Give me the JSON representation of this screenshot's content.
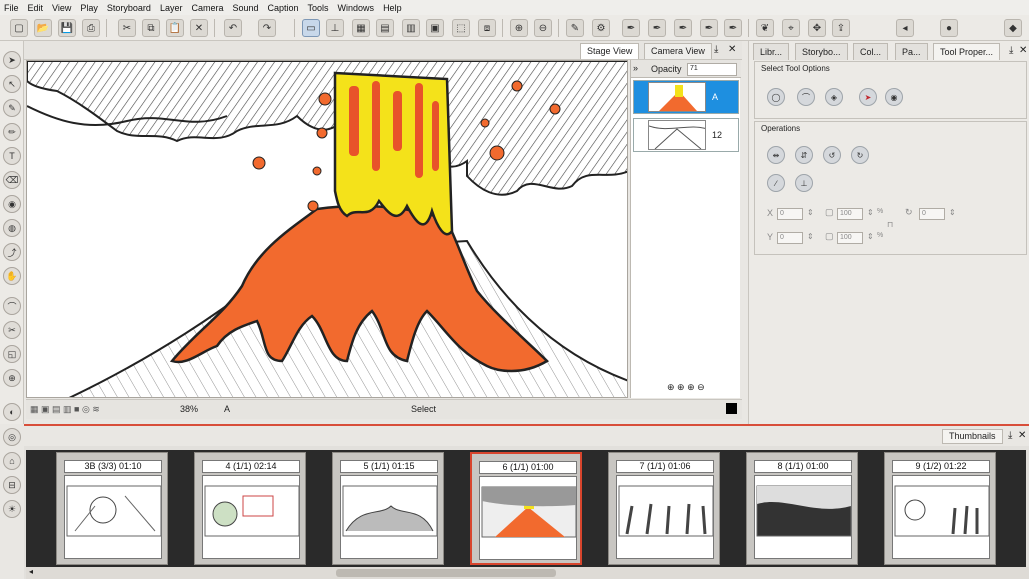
{
  "menu": [
    "File",
    "Edit",
    "View",
    "Play",
    "Storyboard",
    "Layer",
    "Camera",
    "Sound",
    "Caption",
    "Tools",
    "Windows",
    "Help"
  ],
  "view_tabs": {
    "stage": "Stage View",
    "camera": "Camera View"
  },
  "layers_panel": {
    "opacity_label": "Opacity",
    "opacity_value": "71",
    "layers": [
      {
        "name": "A",
        "selected": true
      },
      {
        "name": "12",
        "selected": false
      }
    ]
  },
  "status": {
    "zoom": "38%",
    "layer": "A",
    "tool": "Select"
  },
  "right_tabs": [
    "Libr...",
    "Storybo...",
    "Col...",
    "Pa...",
    "Tool Proper..."
  ],
  "tool_options": {
    "title": "Select Tool Options",
    "operations_title": "Operations",
    "x_label": "X",
    "y_label": "Y",
    "x_value": "0",
    "y_value": "0",
    "w_value": "100",
    "h_value": "100",
    "angle_value": "0",
    "pct": "%"
  },
  "thumbnails": {
    "title": "Thumbnails",
    "panels": [
      {
        "label": "3B (3/3) 01:10",
        "selected": false
      },
      {
        "label": "4 (1/1) 02:14",
        "selected": false
      },
      {
        "label": "5 (1/1) 01:15",
        "selected": false
      },
      {
        "label": "6 (1/1) 01:00",
        "selected": true
      },
      {
        "label": "7 (1/1) 01:06",
        "selected": false
      },
      {
        "label": "8 (1/1) 01:00",
        "selected": false
      },
      {
        "label": "9 (1/2) 01:22",
        "selected": false
      }
    ]
  },
  "colors": {
    "selection": "#1e8fe0",
    "panel_highlight": "#d8452d",
    "lava": "#f26a2e",
    "fire": "#f4e21a"
  }
}
